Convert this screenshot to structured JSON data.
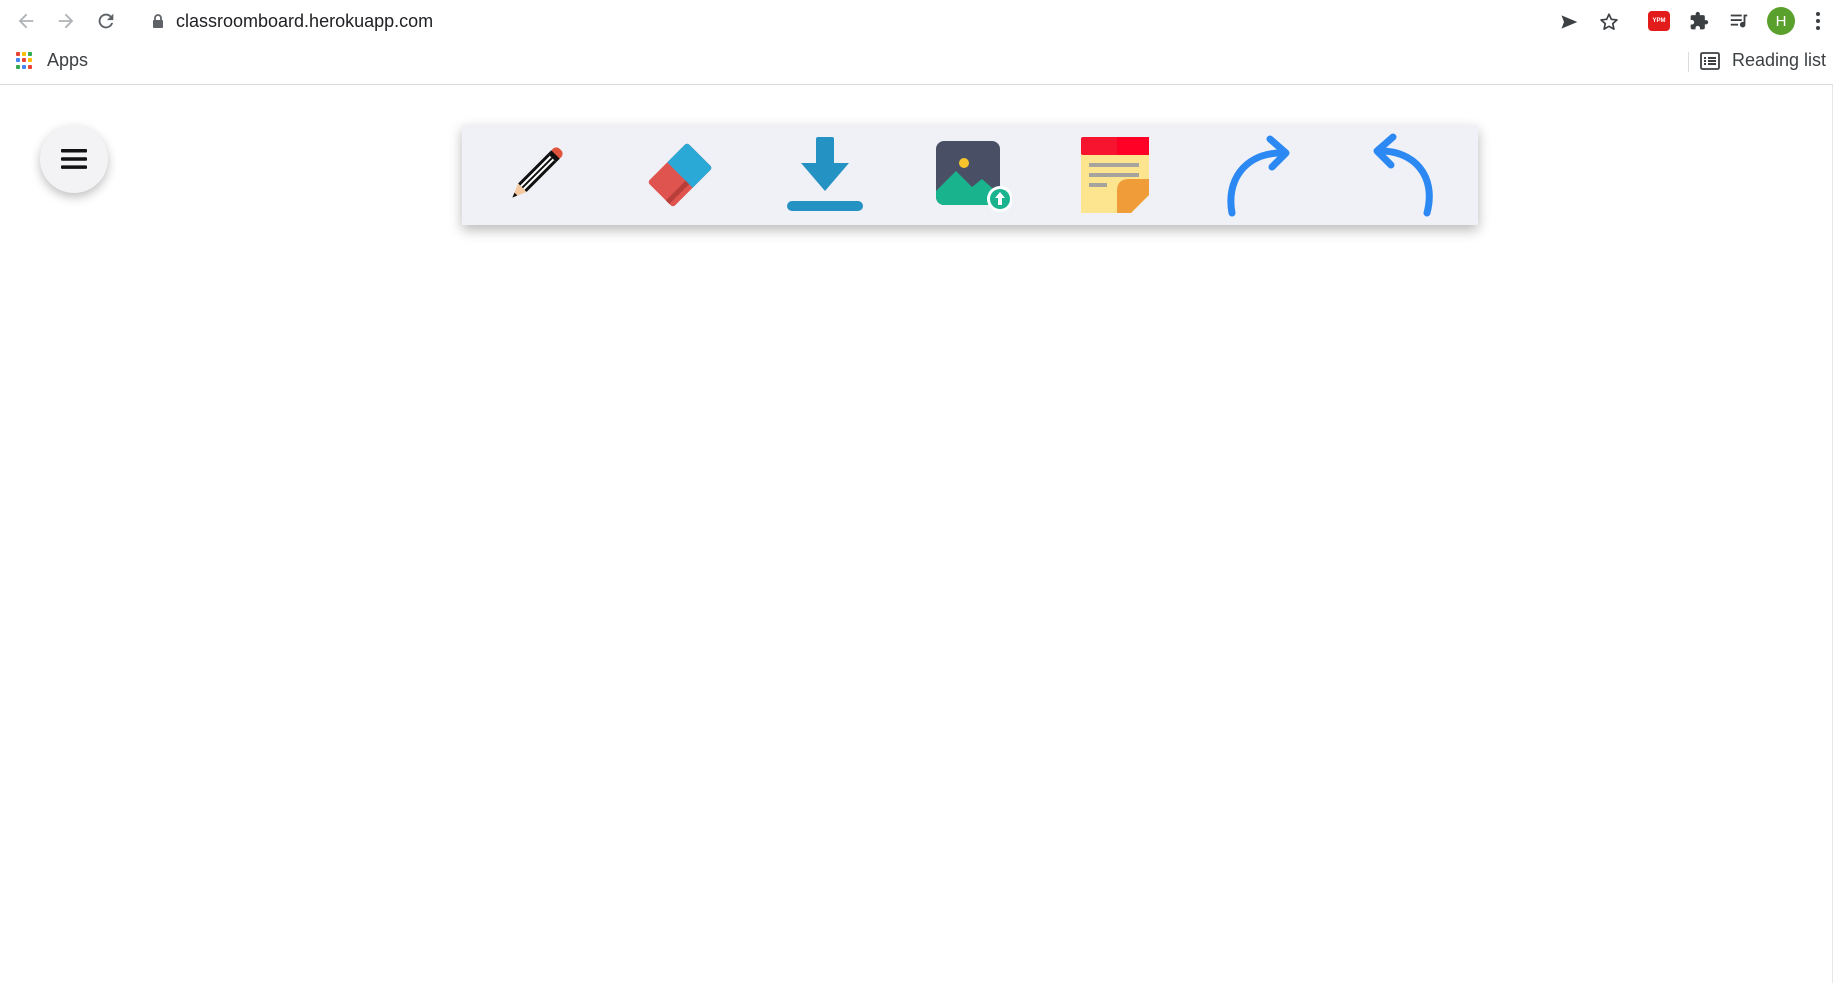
{
  "browser": {
    "url": "classroomboard.herokuapp.com",
    "profile_initial": "H",
    "extension_badge": "YPM",
    "bookmarks": {
      "apps_label": "Apps",
      "reading_list_label": "Reading list"
    },
    "colors": {
      "avatar": "#5aa02c",
      "extension": "#e21b1b"
    }
  },
  "app": {
    "menu_button_icon": "hamburger-icon",
    "toolbar": {
      "background": "#f0f1f6",
      "tools": [
        {
          "name": "pencil",
          "icon": "pencil-icon"
        },
        {
          "name": "eraser",
          "icon": "eraser-icon"
        },
        {
          "name": "download",
          "icon": "download-icon"
        },
        {
          "name": "upload-image",
          "icon": "image-upload-icon"
        },
        {
          "name": "sticky-note",
          "icon": "sticky-note-icon"
        },
        {
          "name": "redo",
          "icon": "redo-icon"
        },
        {
          "name": "undo",
          "icon": "undo-icon"
        }
      ]
    }
  }
}
